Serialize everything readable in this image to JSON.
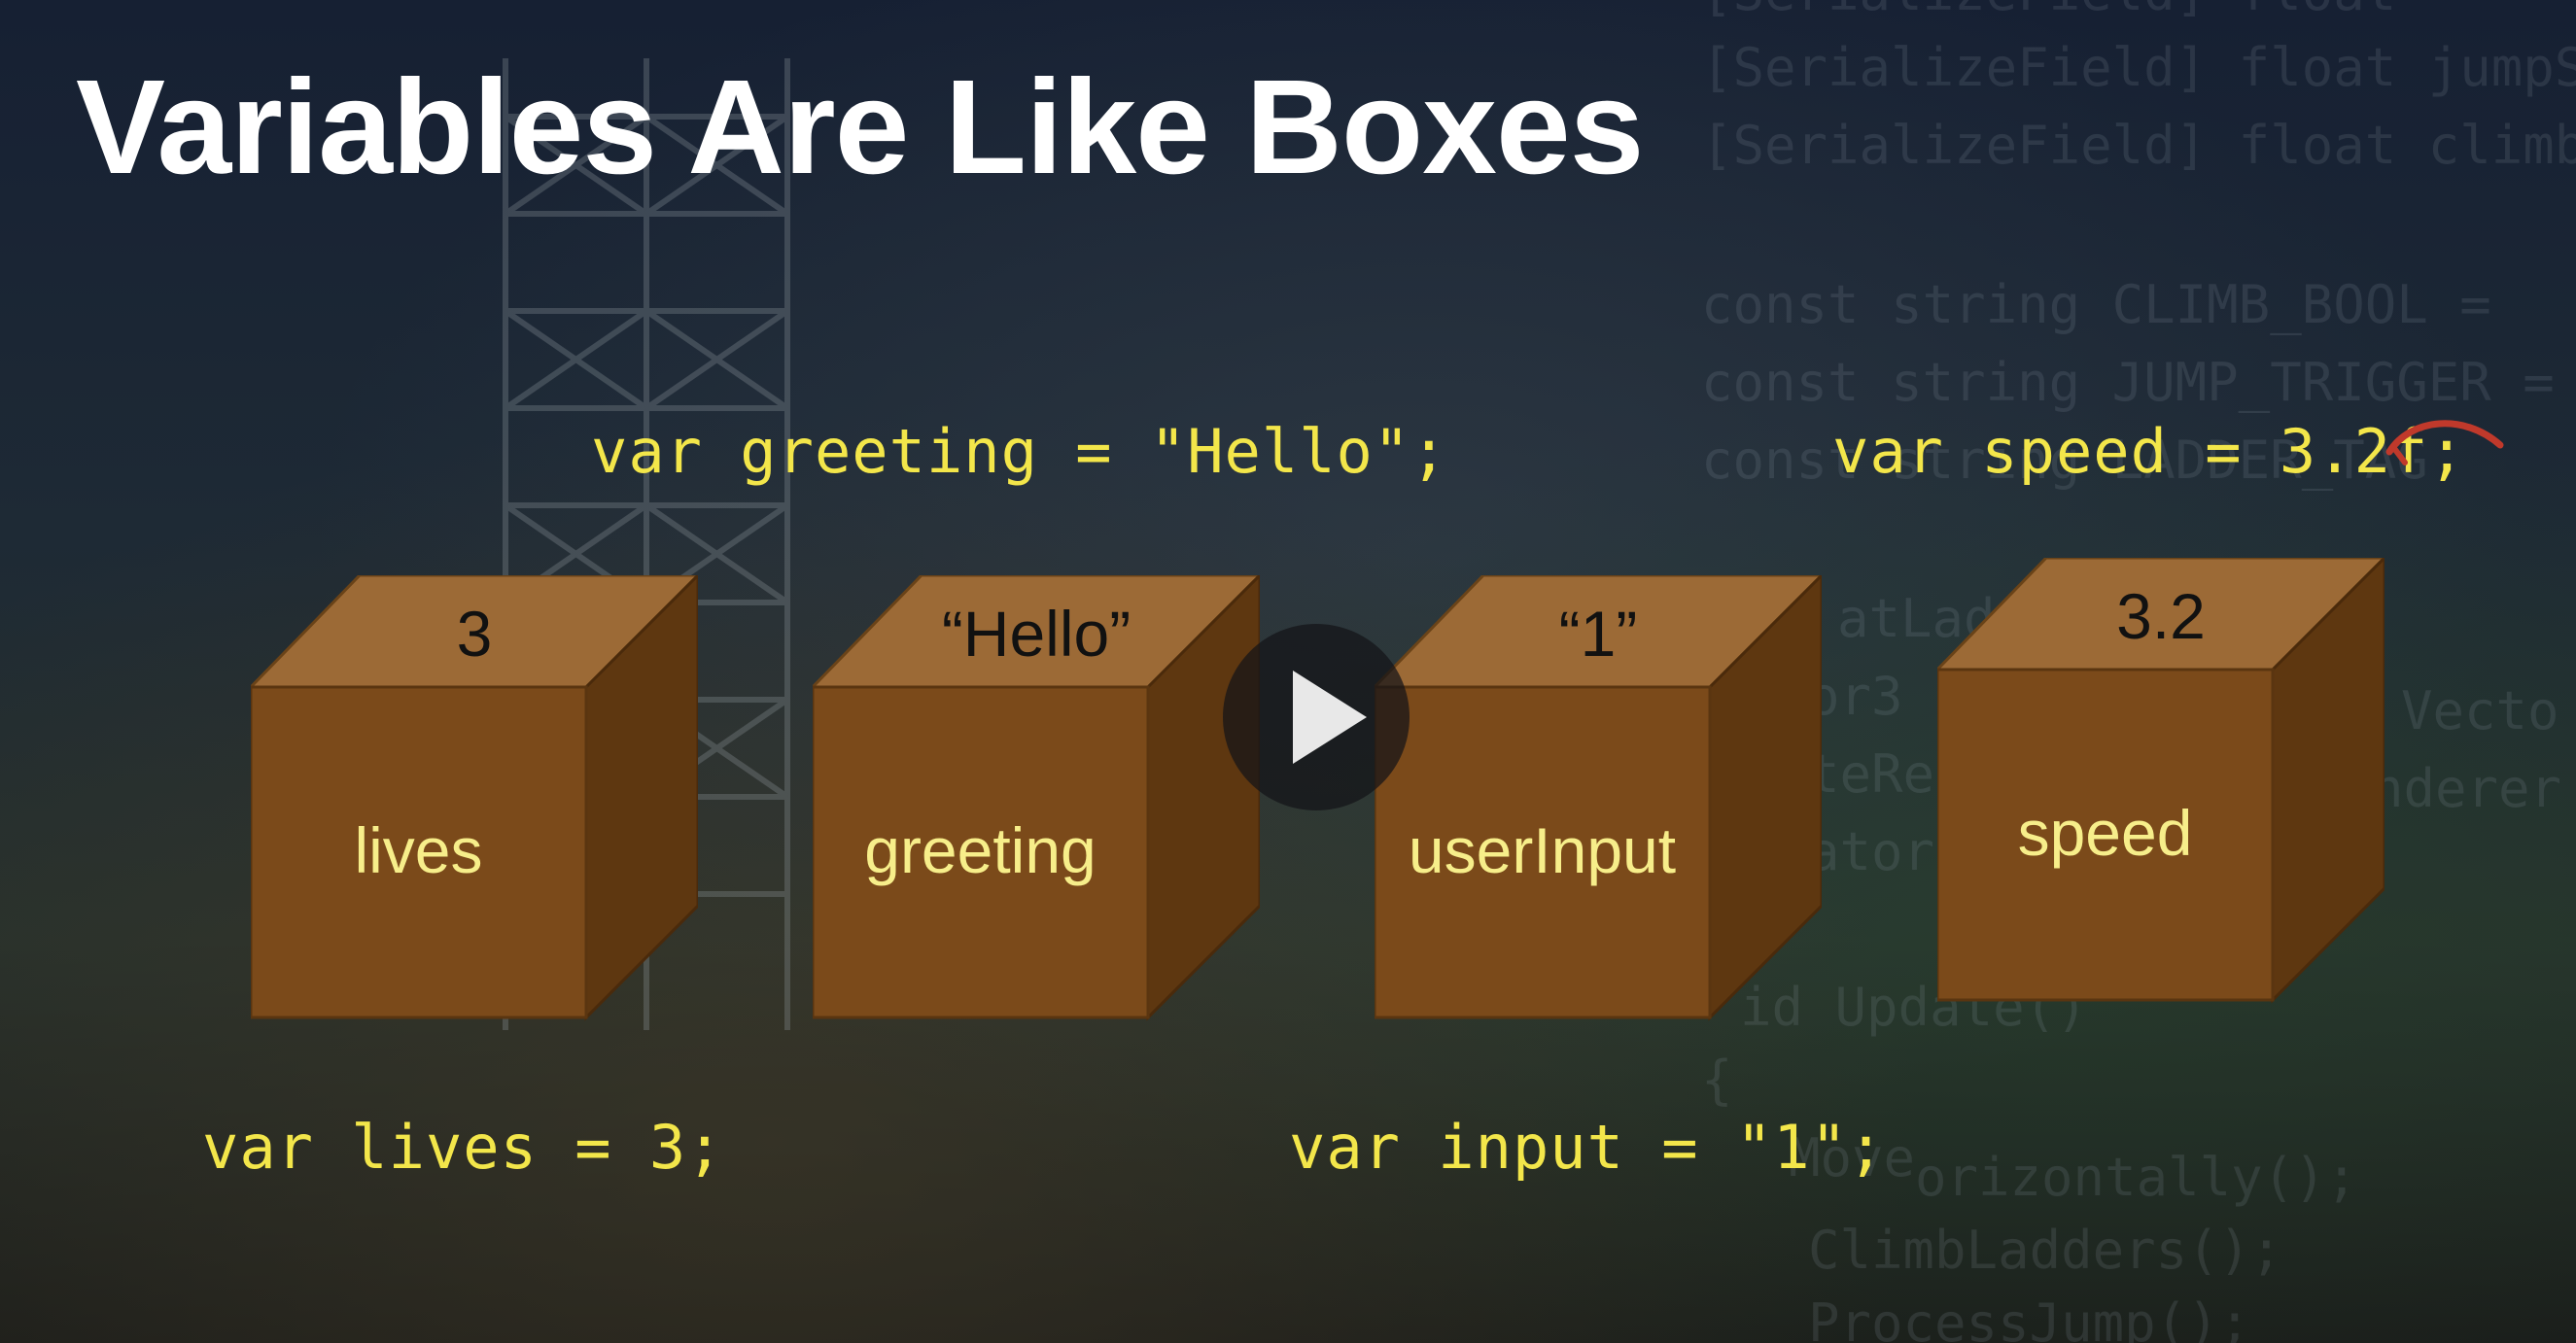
{
  "slide": {
    "title": "Variables Are Like Boxes"
  },
  "background_code": {
    "line1": "[SerializeField] float ",
    "line2": "[SerializeField] float jumpSp",
    "line3": "[SerializeField] float climbS",
    "line4": "const string CLIMB_BOOL =",
    "line5": "const string JUMP_TRIGGER =",
    "line6": "const string LADDER_TAG",
    "line7": "atLad",
    "line8": "or3",
    "line9": "teRe",
    "line10": "ator",
    "line11": "Vecto",
    "line12": "nderer",
    "line13": "id Update()",
    "line14": "{",
    "line15": "Move",
    "line16": "orizontally();",
    "line17": "ClimbLadders();",
    "line18": "ProcessJump();"
  },
  "code": {
    "greeting_decl": "var greeting = \"Hello\";",
    "speed_decl": "var speed = 3.2f;",
    "lives_decl": "var lives = 3;",
    "input_decl": "var input = \"1\";"
  },
  "boxes": [
    {
      "label": "lives",
      "value": "3"
    },
    {
      "label": "greeting",
      "value": "“Hello”"
    },
    {
      "label": "userInput",
      "value": "“1”"
    },
    {
      "label": "speed",
      "value": "3.2"
    }
  ],
  "colors": {
    "title": "#ffffff",
    "code": "#f3e64a",
    "box_label": "#f7ee8a",
    "box_front": "#7b4a1a",
    "box_top": "#9c6a36",
    "box_side": "#5e3710",
    "pen_mark": "#c0392b"
  },
  "icons": {
    "play": "play-icon"
  }
}
